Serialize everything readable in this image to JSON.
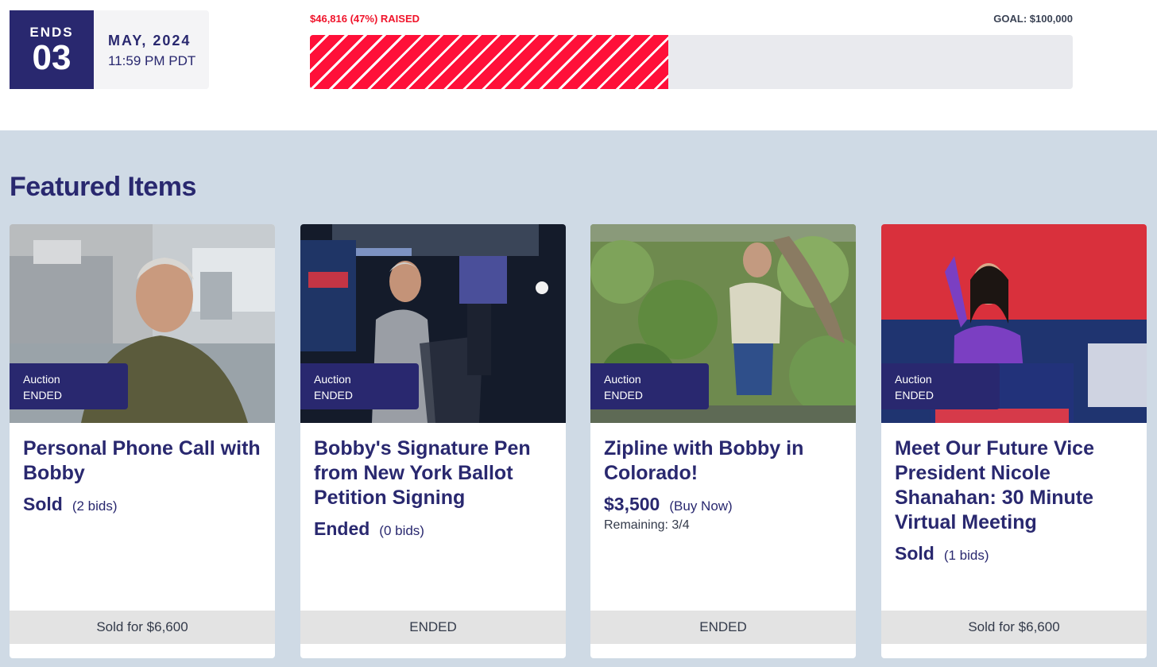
{
  "countdown": {
    "ends_label": "ENDS",
    "day": "03",
    "month_year": "MAY, 2024",
    "time": "11:59 PM PDT"
  },
  "fundraising": {
    "raised_text": "$46,816 (47%) RAISED",
    "goal_text": "GOAL: $100,000",
    "progress_fraction": 0.47,
    "fill_color": "#ff1039"
  },
  "featured": {
    "title": "Featured Items",
    "cards": [
      {
        "badge_type": "Auction",
        "badge_status": "ENDED",
        "title": "Personal Phone Call with Bobby",
        "price": "Sold",
        "bids": "(2 bids)",
        "remaining": "",
        "footer": "Sold for $6,600",
        "image_icon": "photo-man-olive-shirt"
      },
      {
        "badge_type": "Auction",
        "badge_status": "ENDED",
        "title": "Bobby's Signature Pen from New York Ballot Petition Signing",
        "price": "Ended",
        "bids": "(0 bids)",
        "remaining": "",
        "footer": "ENDED",
        "image_icon": "photo-man-signing-podium"
      },
      {
        "badge_type": "Auction",
        "badge_status": "ENDED",
        "title": "Zipline with Bobby in Colorado!",
        "price": "$3,500",
        "bids": "(Buy Now)",
        "remaining": "Remaining: 3/4",
        "footer": "ENDED",
        "image_icon": "photo-man-in-tree"
      },
      {
        "badge_type": "Auction",
        "badge_status": "ENDED",
        "title": "Meet Our Future Vice President Nicole Shanahan: 30 Minute Virtual Meeting",
        "price": "Sold",
        "bids": "(1 bids)",
        "remaining": "",
        "footer": "Sold for $6,600",
        "image_icon": "photo-woman-waving-podium"
      }
    ]
  },
  "colors": {
    "navy": "#29286f",
    "section_bg": "#cfdae5",
    "raised_red": "#f0142b"
  }
}
